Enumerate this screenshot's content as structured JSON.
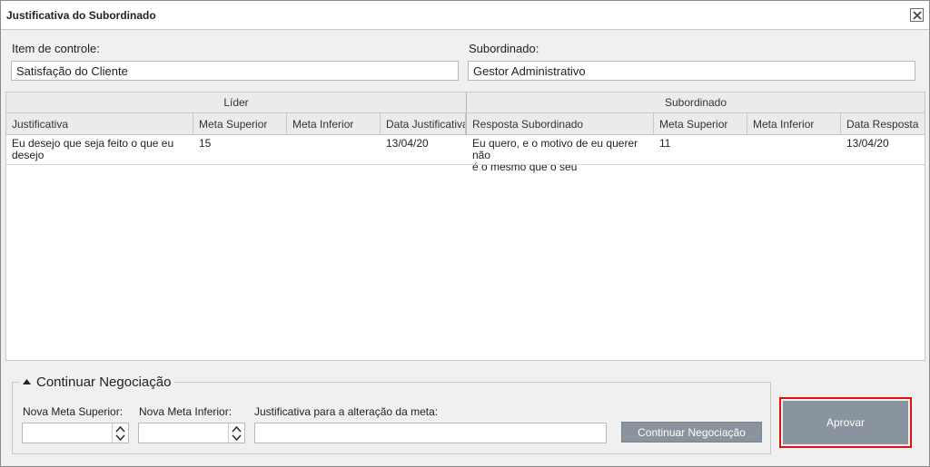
{
  "window": {
    "title": "Justificativa do Subordinado",
    "close_icon": "close-icon"
  },
  "form": {
    "item_label": "Item de controle:",
    "item_value": "Satisfação do Cliente",
    "subordinate_label": "Subordinado:",
    "subordinate_value": "Gestor Administrativo"
  },
  "grid": {
    "groups": [
      "Líder",
      "Subordinado"
    ],
    "columns": [
      "Justificativa",
      "Meta Superior",
      "Meta Inferior",
      "Data Justificativa",
      "Resposta Subordinado",
      "Meta Superior",
      "Meta Inferior",
      "Data Resposta"
    ],
    "rows": [
      {
        "justificativa_l1": "Eu desejo que seja feito o que eu",
        "justificativa_l2": "desejo",
        "meta_superior": "15",
        "meta_inferior": "",
        "data_justificativa": "13/04/20",
        "resposta_l1": "Eu quero, e o motivo de eu querer não",
        "resposta_l2": "é o mesmo que o seu",
        "resp_meta_superior": "11",
        "resp_meta_inferior": "",
        "data_resposta": "13/04/20"
      }
    ]
  },
  "negotiation": {
    "title": "Continuar Negociação",
    "expand_icon": "triangle-up-icon",
    "nova_meta_superior_label": "Nova Meta Superior:",
    "nova_meta_superior_value": "",
    "nova_meta_inferior_label": "Nova Meta Inferior:",
    "nova_meta_inferior_value": "",
    "justificativa_label": "Justificativa para a alteração da meta:",
    "justificativa_value": "",
    "continue_button": "Continuar Negociação"
  },
  "approve_button": "Aprovar",
  "colors": {
    "button_bg": "#8a949e",
    "highlight": "#e01010"
  }
}
